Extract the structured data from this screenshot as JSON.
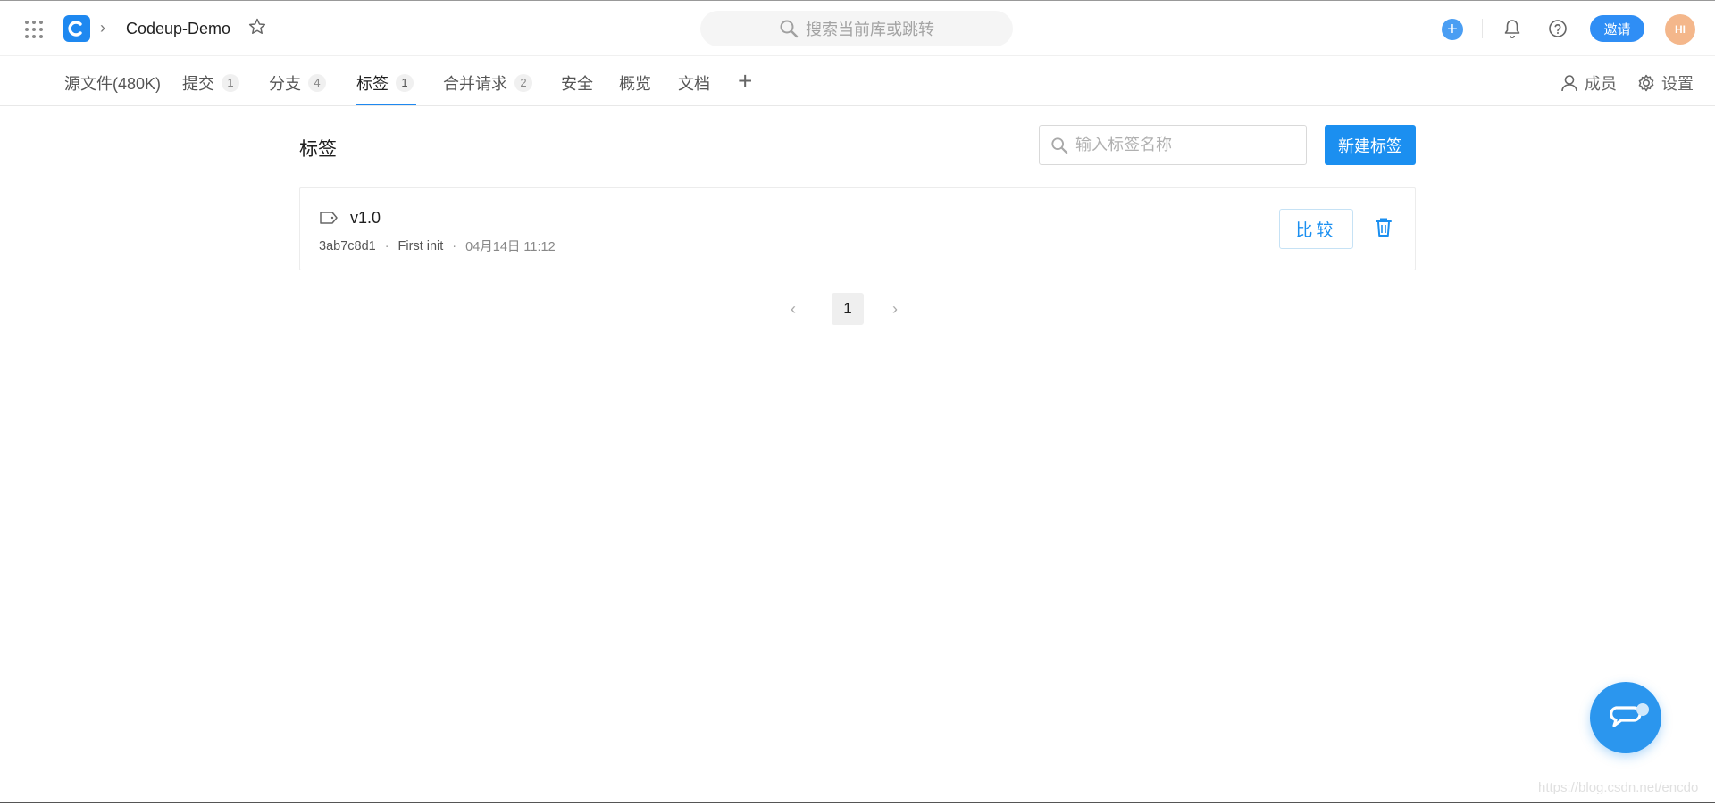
{
  "header": {
    "repo_name": "Codeup-Demo",
    "search_placeholder": "搜索当前库或跳转",
    "add_icon": "+",
    "invite_label": "邀请",
    "avatar_initials": "HI"
  },
  "tabs": [
    {
      "label": "源文件(480K)",
      "count": null
    },
    {
      "label": "提交",
      "count": "1"
    },
    {
      "label": "分支",
      "count": "4"
    },
    {
      "label": "标签",
      "count": "1",
      "active": true
    },
    {
      "label": "合并请求",
      "count": "2"
    },
    {
      "label": "安全",
      "count": null
    },
    {
      "label": "概览",
      "count": null
    },
    {
      "label": "文档",
      "count": null
    }
  ],
  "tab_actions": {
    "plus": "+",
    "members_label": "成员",
    "settings_label": "设置"
  },
  "main": {
    "title": "标签",
    "tag_search_placeholder": "输入标签名称",
    "new_tag_label": "新建标签"
  },
  "tags": [
    {
      "name": "v1.0",
      "commit": "3ab7c8d1",
      "message": "First init",
      "time": "04月14日 11:12",
      "compare_label": "比较"
    }
  ],
  "meta_separator": "·",
  "pagination": {
    "prev": "‹",
    "current": "1",
    "next": "›"
  },
  "watermark": "https://blog.csdn.net/encdo",
  "colors": {
    "accent": "#1b8ff0",
    "avatar_bg": "#f4b78b"
  }
}
